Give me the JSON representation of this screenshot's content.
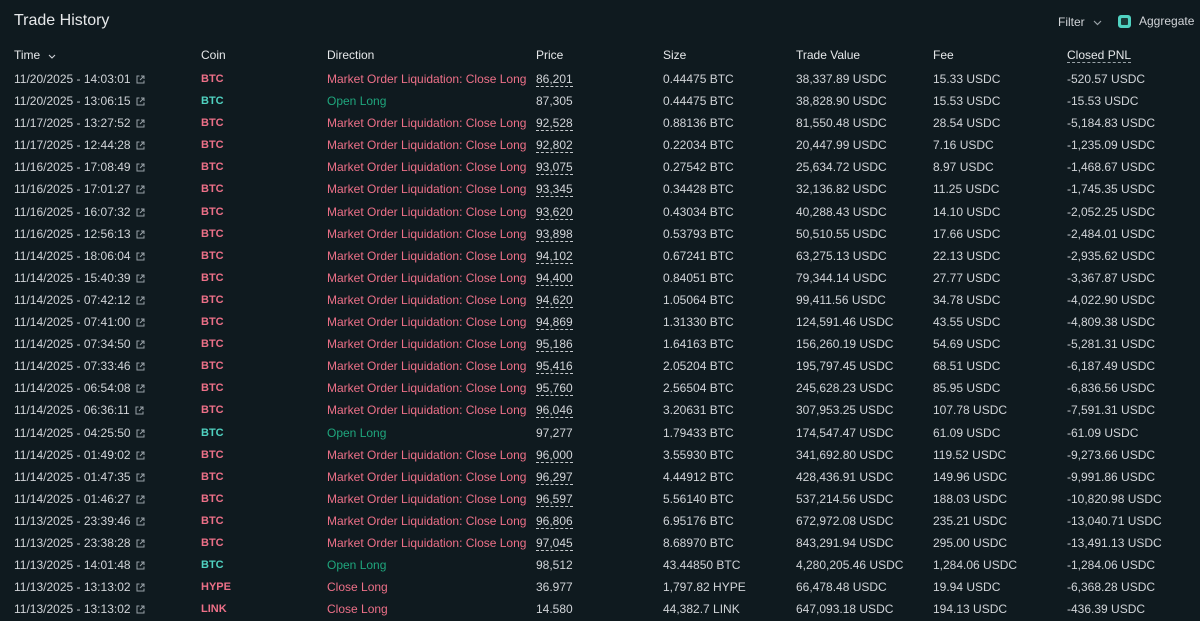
{
  "header": {
    "title": "Trade History",
    "filter_label": "Filter",
    "aggregate_label": "Aggregate"
  },
  "columns": {
    "time": "Time",
    "coin": "Coin",
    "direction": "Direction",
    "price": "Price",
    "size": "Size",
    "trade_value": "Trade Value",
    "fee": "Fee",
    "closed_pnl": "Closed PNL"
  },
  "colors": {
    "background": "#0f1a1f",
    "sell": "#ed7088",
    "buy": "#1fa67d",
    "accent": "#50d2c1"
  },
  "rows": [
    {
      "time": "11/20/2025 - 14:03:01",
      "coin": "BTC",
      "direction": "Market Order Liquidation: Close Long",
      "side": "sell",
      "price": "86,201",
      "price_dashed": true,
      "size": "0.44475 BTC",
      "value": "38,337.89 USDC",
      "fee": "15.33 USDC",
      "pnl": "-520.57 USDC"
    },
    {
      "time": "11/20/2025 - 13:06:15",
      "coin": "BTC",
      "direction": "Open Long",
      "side": "buy",
      "price": "87,305",
      "price_dashed": false,
      "size": "0.44475 BTC",
      "value": "38,828.90 USDC",
      "fee": "15.53 USDC",
      "pnl": "-15.53 USDC"
    },
    {
      "time": "11/17/2025 - 13:27:52",
      "coin": "BTC",
      "direction": "Market Order Liquidation: Close Long",
      "side": "sell",
      "price": "92,528",
      "price_dashed": true,
      "size": "0.88136 BTC",
      "value": "81,550.48 USDC",
      "fee": "28.54 USDC",
      "pnl": "-5,184.83 USDC"
    },
    {
      "time": "11/17/2025 - 12:44:28",
      "coin": "BTC",
      "direction": "Market Order Liquidation: Close Long",
      "side": "sell",
      "price": "92,802",
      "price_dashed": true,
      "size": "0.22034 BTC",
      "value": "20,447.99 USDC",
      "fee": "7.16 USDC",
      "pnl": "-1,235.09 USDC"
    },
    {
      "time": "11/16/2025 - 17:08:49",
      "coin": "BTC",
      "direction": "Market Order Liquidation: Close Long",
      "side": "sell",
      "price": "93,075",
      "price_dashed": true,
      "size": "0.27542 BTC",
      "value": "25,634.72 USDC",
      "fee": "8.97 USDC",
      "pnl": "-1,468.67 USDC"
    },
    {
      "time": "11/16/2025 - 17:01:27",
      "coin": "BTC",
      "direction": "Market Order Liquidation: Close Long",
      "side": "sell",
      "price": "93,345",
      "price_dashed": true,
      "size": "0.34428 BTC",
      "value": "32,136.82 USDC",
      "fee": "11.25 USDC",
      "pnl": "-1,745.35 USDC"
    },
    {
      "time": "11/16/2025 - 16:07:32",
      "coin": "BTC",
      "direction": "Market Order Liquidation: Close Long",
      "side": "sell",
      "price": "93,620",
      "price_dashed": true,
      "size": "0.43034 BTC",
      "value": "40,288.43 USDC",
      "fee": "14.10 USDC",
      "pnl": "-2,052.25 USDC"
    },
    {
      "time": "11/16/2025 - 12:56:13",
      "coin": "BTC",
      "direction": "Market Order Liquidation: Close Long",
      "side": "sell",
      "price": "93,898",
      "price_dashed": true,
      "size": "0.53793 BTC",
      "value": "50,510.55 USDC",
      "fee": "17.66 USDC",
      "pnl": "-2,484.01 USDC"
    },
    {
      "time": "11/14/2025 - 18:06:04",
      "coin": "BTC",
      "direction": "Market Order Liquidation: Close Long",
      "side": "sell",
      "price": "94,102",
      "price_dashed": true,
      "size": "0.67241 BTC",
      "value": "63,275.13 USDC",
      "fee": "22.13 USDC",
      "pnl": "-2,935.62 USDC"
    },
    {
      "time": "11/14/2025 - 15:40:39",
      "coin": "BTC",
      "direction": "Market Order Liquidation: Close Long",
      "side": "sell",
      "price": "94,400",
      "price_dashed": true,
      "size": "0.84051 BTC",
      "value": "79,344.14 USDC",
      "fee": "27.77 USDC",
      "pnl": "-3,367.87 USDC"
    },
    {
      "time": "11/14/2025 - 07:42:12",
      "coin": "BTC",
      "direction": "Market Order Liquidation: Close Long",
      "side": "sell",
      "price": "94,620",
      "price_dashed": true,
      "size": "1.05064 BTC",
      "value": "99,411.56 USDC",
      "fee": "34.78 USDC",
      "pnl": "-4,022.90 USDC"
    },
    {
      "time": "11/14/2025 - 07:41:00",
      "coin": "BTC",
      "direction": "Market Order Liquidation: Close Long",
      "side": "sell",
      "price": "94,869",
      "price_dashed": true,
      "size": "1.31330 BTC",
      "value": "124,591.46 USDC",
      "fee": "43.55 USDC",
      "pnl": "-4,809.38 USDC"
    },
    {
      "time": "11/14/2025 - 07:34:50",
      "coin": "BTC",
      "direction": "Market Order Liquidation: Close Long",
      "side": "sell",
      "price": "95,186",
      "price_dashed": true,
      "size": "1.64163 BTC",
      "value": "156,260.19 USDC",
      "fee": "54.69 USDC",
      "pnl": "-5,281.31 USDC"
    },
    {
      "time": "11/14/2025 - 07:33:46",
      "coin": "BTC",
      "direction": "Market Order Liquidation: Close Long",
      "side": "sell",
      "price": "95,416",
      "price_dashed": true,
      "size": "2.05204 BTC",
      "value": "195,797.45 USDC",
      "fee": "68.51 USDC",
      "pnl": "-6,187.49 USDC"
    },
    {
      "time": "11/14/2025 - 06:54:08",
      "coin": "BTC",
      "direction": "Market Order Liquidation: Close Long",
      "side": "sell",
      "price": "95,760",
      "price_dashed": true,
      "size": "2.56504 BTC",
      "value": "245,628.23 USDC",
      "fee": "85.95 USDC",
      "pnl": "-6,836.56 USDC"
    },
    {
      "time": "11/14/2025 - 06:36:11",
      "coin": "BTC",
      "direction": "Market Order Liquidation: Close Long",
      "side": "sell",
      "price": "96,046",
      "price_dashed": true,
      "size": "3.20631 BTC",
      "value": "307,953.25 USDC",
      "fee": "107.78 USDC",
      "pnl": "-7,591.31 USDC"
    },
    {
      "time": "11/14/2025 - 04:25:50",
      "coin": "BTC",
      "direction": "Open Long",
      "side": "buy",
      "price": "97,277",
      "price_dashed": false,
      "size": "1.79433 BTC",
      "value": "174,547.47 USDC",
      "fee": "61.09 USDC",
      "pnl": "-61.09 USDC"
    },
    {
      "time": "11/14/2025 - 01:49:02",
      "coin": "BTC",
      "direction": "Market Order Liquidation: Close Long",
      "side": "sell",
      "price": "96,000",
      "price_dashed": true,
      "size": "3.55930 BTC",
      "value": "341,692.80 USDC",
      "fee": "119.52 USDC",
      "pnl": "-9,273.66 USDC"
    },
    {
      "time": "11/14/2025 - 01:47:35",
      "coin": "BTC",
      "direction": "Market Order Liquidation: Close Long",
      "side": "sell",
      "price": "96,297",
      "price_dashed": true,
      "size": "4.44912 BTC",
      "value": "428,436.91 USDC",
      "fee": "149.96 USDC",
      "pnl": "-9,991.86 USDC"
    },
    {
      "time": "11/14/2025 - 01:46:27",
      "coin": "BTC",
      "direction": "Market Order Liquidation: Close Long",
      "side": "sell",
      "price": "96,597",
      "price_dashed": true,
      "size": "5.56140 BTC",
      "value": "537,214.56 USDC",
      "fee": "188.03 USDC",
      "pnl": "-10,820.98 USDC"
    },
    {
      "time": "11/13/2025 - 23:39:46",
      "coin": "BTC",
      "direction": "Market Order Liquidation: Close Long",
      "side": "sell",
      "price": "96,806",
      "price_dashed": true,
      "size": "6.95176 BTC",
      "value": "672,972.08 USDC",
      "fee": "235.21 USDC",
      "pnl": "-13,040.71 USDC"
    },
    {
      "time": "11/13/2025 - 23:38:28",
      "coin": "BTC",
      "direction": "Market Order Liquidation: Close Long",
      "side": "sell",
      "price": "97,045",
      "price_dashed": true,
      "size": "8.68970 BTC",
      "value": "843,291.94 USDC",
      "fee": "295.00 USDC",
      "pnl": "-13,491.13 USDC"
    },
    {
      "time": "11/13/2025 - 14:01:48",
      "coin": "BTC",
      "direction": "Open Long",
      "side": "buy",
      "price": "98,512",
      "price_dashed": false,
      "size": "43.44850 BTC",
      "value": "4,280,205.46 USDC",
      "fee": "1,284.06 USDC",
      "pnl": "-1,284.06 USDC"
    },
    {
      "time": "11/13/2025 - 13:13:02",
      "coin": "HYPE",
      "direction": "Close Long",
      "side": "sell",
      "price": "36.977",
      "price_dashed": false,
      "size": "1,797.82 HYPE",
      "value": "66,478.48 USDC",
      "fee": "19.94 USDC",
      "pnl": "-6,368.28 USDC"
    },
    {
      "time": "11/13/2025 - 13:13:02",
      "coin": "LINK",
      "direction": "Close Long",
      "side": "sell",
      "price": "14.580",
      "price_dashed": false,
      "size": "44,382.7 LINK",
      "value": "647,093.18 USDC",
      "fee": "194.13 USDC",
      "pnl": "-436.39 USDC"
    }
  ]
}
